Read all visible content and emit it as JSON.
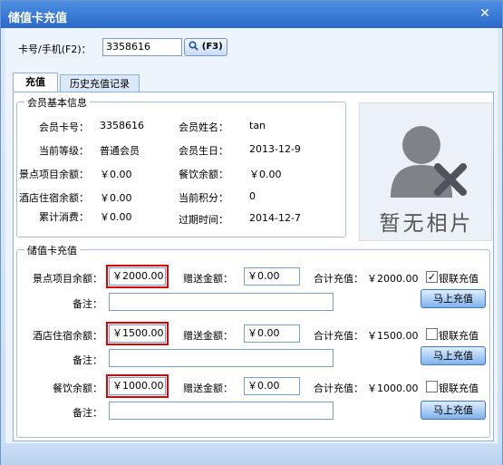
{
  "window": {
    "title": "储值卡充值",
    "close_glyph": "✕"
  },
  "search": {
    "label": "卡号/手机(F2)：",
    "value": "3358616",
    "button_label": "(F3)",
    "button_icon": "search-icon"
  },
  "tabs": [
    {
      "label": "充值"
    },
    {
      "label": "历史充值记录"
    }
  ],
  "member": {
    "group_label": "会员基本信息",
    "card_no_label": "会员卡号：",
    "card_no": "3358616",
    "name_label": "会员姓名：",
    "name": "tan",
    "level_label": "当前等级：",
    "level": "普通会员",
    "birthday_label": "会员生日：",
    "birthday": "2013-12-9",
    "scenic_balance_label": "景点项目余额：",
    "scenic_balance": "￥0.00",
    "catering_balance_label": "餐饮余额：",
    "catering_balance": "￥0.00",
    "hotel_balance_label": "酒店住宿余额：",
    "hotel_balance": "￥0.00",
    "points_label": "当前积分：",
    "points": "0",
    "total_spent_label": "累计消费：",
    "total_spent": "￥0.00",
    "expiry_label": "过期时间：",
    "expiry": "2014-12-7",
    "photo_placeholder": "暂无相片"
  },
  "recharge": {
    "group_label": "储值卡充值",
    "gift_label": "赠送金额：",
    "total_label": "合计充值：",
    "note_label": "备注：",
    "unionpay_label": "银联充值",
    "button_label": "马上充值",
    "rows": [
      {
        "label": "景点项目余额：",
        "amount": "￥2000.00",
        "gift": "￥0.00",
        "total": "￥2000.00",
        "unionpay_checked": true,
        "note": ""
      },
      {
        "label": "酒店住宿余额：",
        "amount": "￥1500.00",
        "gift": "￥0.00",
        "total": "￥1500.00",
        "unionpay_checked": false,
        "note": ""
      },
      {
        "label": "餐饮余额：",
        "amount": "￥1000.00",
        "gift": "￥0.00",
        "total": "￥1000.00",
        "unionpay_checked": false,
        "note": ""
      }
    ]
  },
  "colors": {
    "titlebar": "#2f70cc",
    "highlight": "#e00000",
    "button": "#7fb2ec"
  }
}
